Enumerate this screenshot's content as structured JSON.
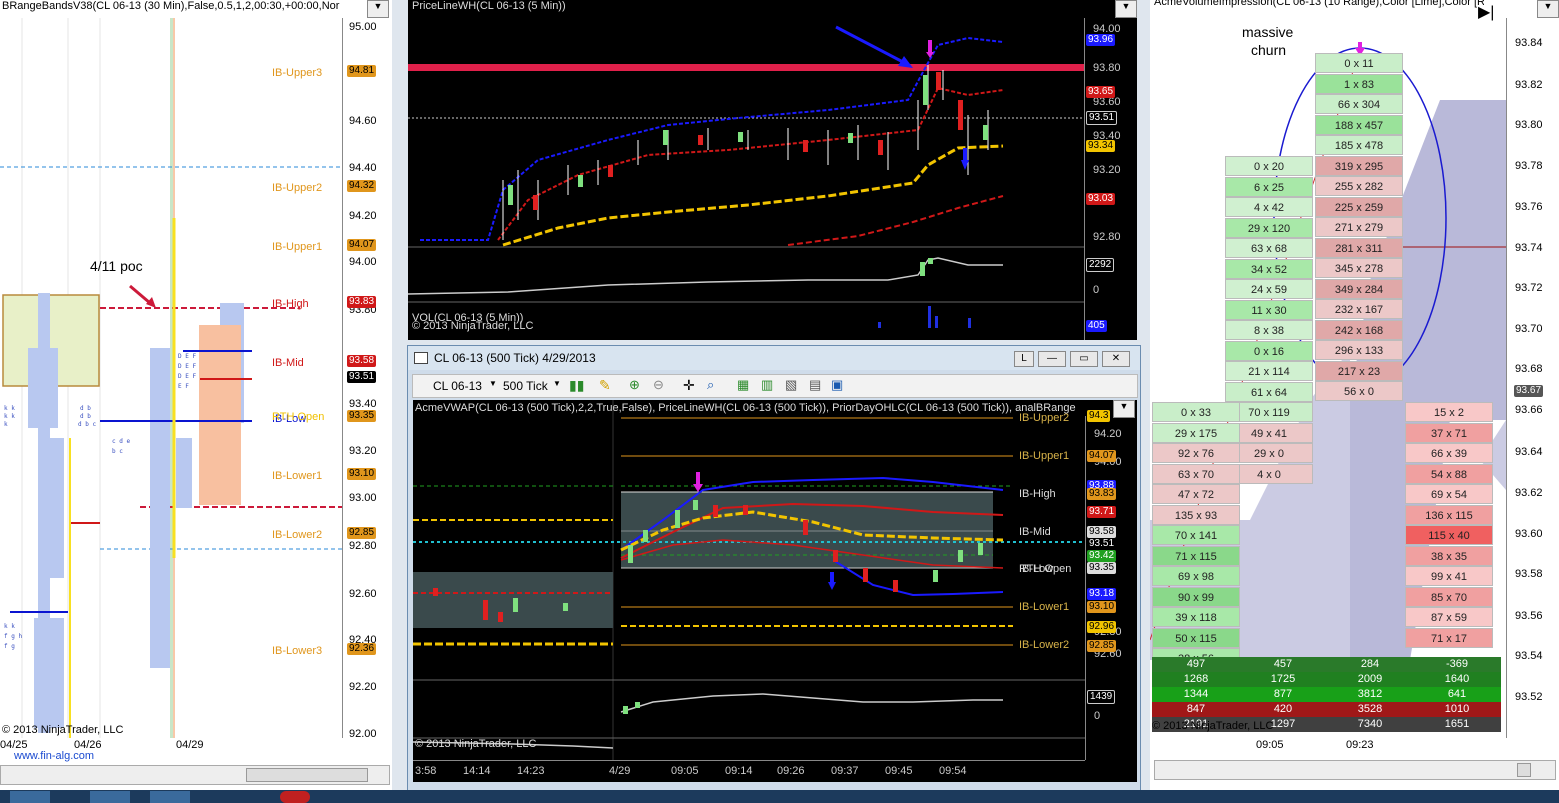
{
  "left_panel": {
    "title": "BRangeBandsV38(CL 06-13 (30 Min),False,0.5,1,2,00:30,+00:00,Nor",
    "poc_note": "4/11 poc",
    "copyright": "© 2013 NinjaTrader, LLC",
    "url": "www.fin-alg.com",
    "prices": [
      "95.00",
      "94.80",
      "94.60",
      "94.40",
      "94.20",
      "94.00",
      "93.80",
      "93.60",
      "93.40",
      "93.20",
      "93.00",
      "92.80",
      "92.60",
      "92.40",
      "92.20",
      "92.00"
    ],
    "levels": [
      {
        "label": "IB-Upper3",
        "tag": "94.81"
      },
      {
        "label": "IB-Upper2",
        "tag": "94.32"
      },
      {
        "label": "IB-Upper1",
        "tag": "94.07"
      },
      {
        "label": "IB-High",
        "tag": "93.83"
      },
      {
        "label": "IB-Mid",
        "tag": "93.58"
      },
      {
        "label": "",
        "tag": "93.51"
      },
      {
        "label": "IB-Low",
        "tag": "93.35"
      },
      {
        "label": "RTH Open",
        "tag": ""
      },
      {
        "label": "IB-Lower1",
        "tag": "93.10"
      },
      {
        "label": "IB-Lower2",
        "tag": "92.85"
      },
      {
        "label": "IB-Lower3",
        "tag": "92.36"
      }
    ],
    "dates": [
      "04/25",
      "04/26",
      "04/29"
    ]
  },
  "top_chart": {
    "title": "PriceLineWH(CL 06-13 (5 Min))",
    "vol_label": "VOL(CL 06-13 (5 Min))",
    "copyright": "© 2013 NinjaTrader, LLC",
    "prices": [
      "94.00",
      "93.80",
      "93.60",
      "93.40",
      "93.20",
      "93.00",
      "92.80"
    ],
    "tags": [
      {
        "v": "93.96",
        "c": "#1a1aff"
      },
      {
        "v": "93.65",
        "c": "#d01818"
      },
      {
        "v": "93.51",
        "c": "#000000"
      },
      {
        "v": "93.34",
        "c": "#f2c400"
      },
      {
        "v": "93.03",
        "c": "#d01818"
      }
    ],
    "vol_tag": "2292",
    "vol_zero": "0",
    "vol2_tag": "405"
  },
  "window": {
    "title": "CL 06-13 (500 Tick)  4/29/2013",
    "toolbar": {
      "instrument": "CL 06-13",
      "interval": "500 Tick"
    },
    "indicator_label": "AcmeVWAP(CL 06-13 (500 Tick),2,2,True,False), PriceLineWH(CL 06-13 (500 Tick)), PriorDayOHLC(CL 06-13 (500 Tick)), analBRange",
    "prices": [
      "94.20",
      "94.00",
      "93.80",
      "93.60",
      "93.40",
      "93.20",
      "93.00",
      "92.80",
      "92.60"
    ],
    "levels": [
      "IB-Upper2",
      "IB-Upper1",
      "IB-High",
      "IB-Mid",
      "RTH Open",
      "IB-Low",
      "IB-Lower1",
      "IB-Lower2"
    ],
    "tags": [
      {
        "v": "94.3",
        "c": "#f2c400"
      },
      {
        "v": "94.07",
        "c": "#e0961c"
      },
      {
        "v": "93.88",
        "c": "#1a1aff"
      },
      {
        "v": "93.83",
        "c": "#e0961c"
      },
      {
        "v": "93.71",
        "c": "#d01818"
      },
      {
        "v": "93.58",
        "c": "#dddddd"
      },
      {
        "v": "93.51",
        "c": "#000000"
      },
      {
        "v": "93.42",
        "c": "#20a020"
      },
      {
        "v": "93.35",
        "c": "#dddddd"
      },
      {
        "v": "93.18",
        "c": "#1a1aff"
      },
      {
        "v": "93.10",
        "c": "#e0961c"
      },
      {
        "v": "92.96",
        "c": "#f2c400"
      },
      {
        "v": "92.85",
        "c": "#e0961c"
      }
    ],
    "vol_tag": "1439",
    "vol_zero": "0",
    "copyright": "© 2013 NinjaTrader, LLC",
    "times": [
      "3:58",
      "14:14",
      "14:23",
      "4/29",
      "09:05",
      "09:14",
      "09:26",
      "09:37",
      "09:45",
      "09:54"
    ]
  },
  "right_panel": {
    "title": "AcmeVolumeImpression(CL 06-13 (10 Range),Color [Lime],Color [Re",
    "annotation_line1": "massive",
    "annotation_line2": "churn",
    "prices": [
      "93.84",
      "93.82",
      "93.80",
      "93.78",
      "93.76",
      "93.74",
      "93.72",
      "93.70",
      "93.68",
      "93.66",
      "93.64",
      "93.62",
      "93.60",
      "93.58",
      "93.56",
      "93.54",
      "93.52"
    ],
    "current_tag": "93.67",
    "col1": [
      "0 x 33",
      "29 x 175",
      "92 x 76",
      "63 x 70",
      "47 x 72",
      "135 x 93",
      "70 x 141",
      "71 x 115",
      "69 x 98",
      "90 x 99",
      "39 x 118",
      "50 x 115",
      "38 x 56"
    ],
    "col2": [
      "0 x 20",
      "6 x 25",
      "4 x 42",
      "29 x 120",
      "63 x 68",
      "34 x 52",
      "24 x 59",
      "11 x 30",
      "8 x 38",
      "0 x 16",
      "21 x 114",
      "61 x 64",
      "70 x 119",
      "49 x 41",
      "29 x 0",
      "4 x 0"
    ],
    "col3": [
      "0 x 11",
      "1 x 83",
      "66 x 304",
      "188 x 457",
      "185 x 478",
      "319 x 295",
      "255 x 282",
      "225 x 259",
      "271 x 279",
      "281 x 311",
      "345 x 278",
      "349 x 284",
      "232 x 167",
      "242 x 168",
      "296 x 133",
      "217 x 23",
      "56 x 0"
    ],
    "col4": [
      "15 x 2",
      "37 x 71",
      "66 x 39",
      "54 x 88",
      "69 x 54",
      "136 x 115",
      "115 x 40",
      "38 x 35",
      "99 x 41",
      "85 x 70",
      "87 x 59",
      "71 x 17"
    ],
    "summary": [
      [
        "497",
        "457",
        "284",
        "-369"
      ],
      [
        "1268",
        "1725",
        "2009",
        "1640"
      ],
      [
        "1344",
        "877",
        "3812",
        "641"
      ],
      [
        "847",
        "420",
        "3528",
        "1010"
      ],
      [
        "2191",
        "1297",
        "7340",
        "1651"
      ]
    ],
    "times": [
      "09:05",
      "09:23"
    ],
    "copyright": "© 2013 NinjaTrader, LLC"
  }
}
